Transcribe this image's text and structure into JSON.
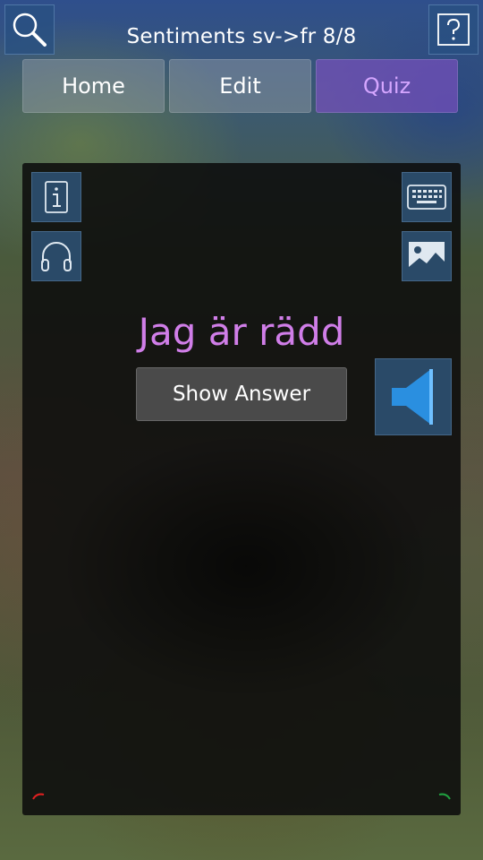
{
  "header": {
    "title": "Sentiments sv->fr 8/8",
    "search_icon": "search-icon",
    "help_icon": "question-mark-icon"
  },
  "nav": {
    "tabs": [
      {
        "label": "Home",
        "active": false
      },
      {
        "label": "Edit",
        "active": false
      },
      {
        "label": "Quiz",
        "active": true
      }
    ]
  },
  "card": {
    "question": "Jag är rädd",
    "show_answer_label": "Show Answer",
    "left_tools": [
      "info-icon",
      "headphones-icon"
    ],
    "right_tools": [
      "keyboard-icon",
      "image-icon"
    ],
    "speaker_icon": "speaker-icon"
  },
  "colors": {
    "accent_quiz": "#d07ee8",
    "button_blue": "#2a4a68",
    "speaker_blue": "#2a8fe0",
    "mark_red": "#e02020",
    "mark_green": "#20a040"
  }
}
